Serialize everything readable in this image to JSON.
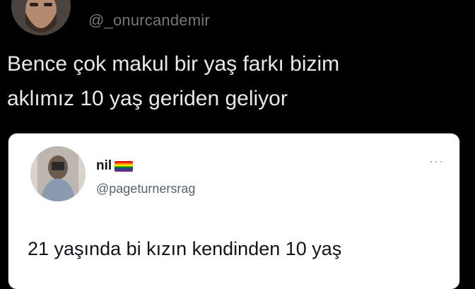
{
  "tweet": {
    "handle": "@_onurcandemir",
    "text_line1": "Bence çok makul bir yaş farkı bizim",
    "text_line2": "aklımız 10 yaş geriden geliyor"
  },
  "quoted": {
    "name": "nil",
    "name_emoji_icon": "rainbow-flag-icon",
    "handle": "@pageturnersrag",
    "more_icon": "more-options-icon",
    "text": "21 yaşında bi kızın kendinden 10 yaş"
  },
  "colors": {
    "background": "#000000",
    "primary_text": "#e7e9ea",
    "secondary_text": "#71767b",
    "card_background": "#ffffff"
  }
}
